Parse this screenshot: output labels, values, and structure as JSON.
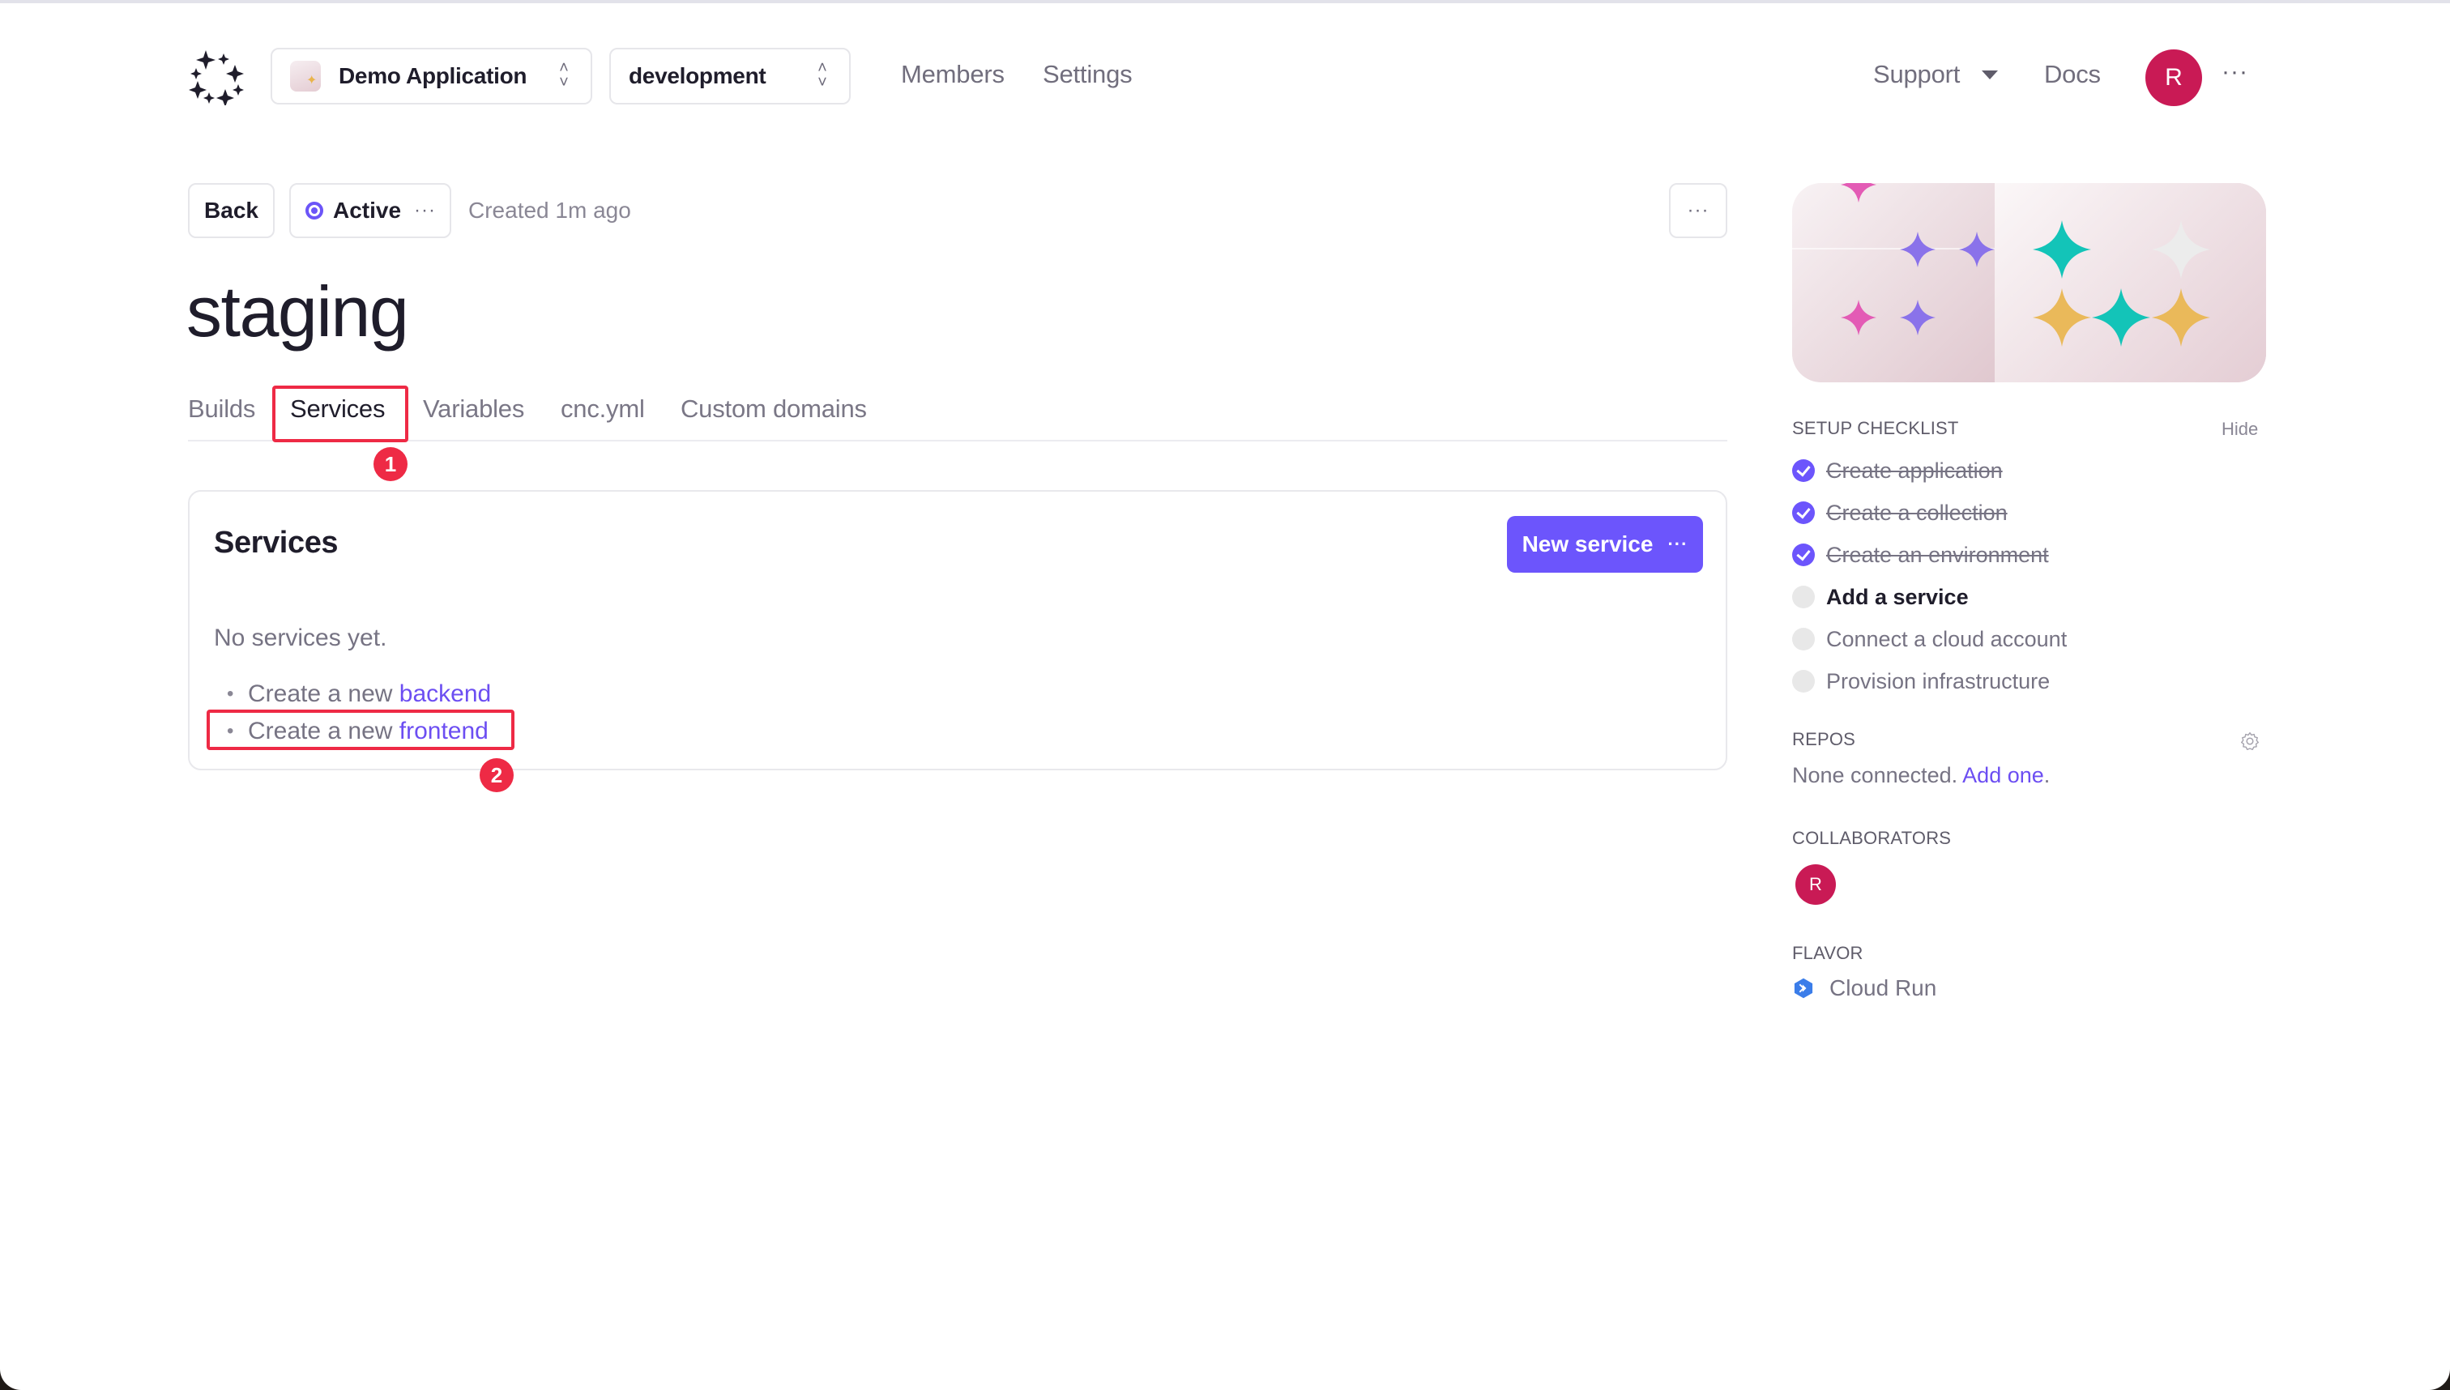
{
  "topnav": {
    "app_selector": {
      "label": "Demo Application",
      "icon": "app-thumbnail"
    },
    "env_selector": {
      "label": "development"
    },
    "links": [
      "Members",
      "Settings"
    ],
    "support_label": "Support",
    "docs_label": "Docs",
    "avatar_initial": "R",
    "more_label": "···"
  },
  "header": {
    "back_label": "Back",
    "status_label": "Active",
    "status_more": "···",
    "created_text": "Created 1m ago",
    "page_more": "···",
    "title": "staging"
  },
  "tabs": [
    {
      "label": "Builds",
      "active": false
    },
    {
      "label": "Services",
      "active": true
    },
    {
      "label": "Variables",
      "active": false
    },
    {
      "label": "cnc.yml",
      "active": false
    },
    {
      "label": "Custom domains",
      "active": false
    }
  ],
  "services_card": {
    "title": "Services",
    "new_button_label": "New service",
    "new_button_more": "···",
    "empty_text": "No services yet.",
    "items": [
      {
        "prefix": "Create a new ",
        "link": "backend"
      },
      {
        "prefix": "Create a new ",
        "link": "frontend"
      }
    ]
  },
  "annotations": [
    {
      "number": "1",
      "target": "Services tab"
    },
    {
      "number": "2",
      "target": "Create a new frontend"
    }
  ],
  "sidebar": {
    "checklist": {
      "heading": "SETUP CHECKLIST",
      "hide_label": "Hide",
      "items": [
        {
          "label": "Create application",
          "state": "done"
        },
        {
          "label": "Create a collection",
          "state": "done"
        },
        {
          "label": "Create an environment",
          "state": "done"
        },
        {
          "label": "Add a service",
          "state": "next"
        },
        {
          "label": "Connect a cloud account",
          "state": "todo"
        },
        {
          "label": "Provision infrastructure",
          "state": "todo"
        }
      ]
    },
    "repos": {
      "heading": "REPOS",
      "text": "None connected. ",
      "link": "Add one",
      "suffix": "."
    },
    "collaborators": {
      "heading": "COLLABORATORS",
      "avatar_initial": "R"
    },
    "flavor": {
      "heading": "FLAVOR",
      "value": "Cloud Run",
      "icon": "cloud-run-icon"
    }
  },
  "colors": {
    "accent": "#6c55fc",
    "avatar": "#c91a55",
    "annotation": "#ee2a45",
    "link": "#6c4ef2"
  }
}
